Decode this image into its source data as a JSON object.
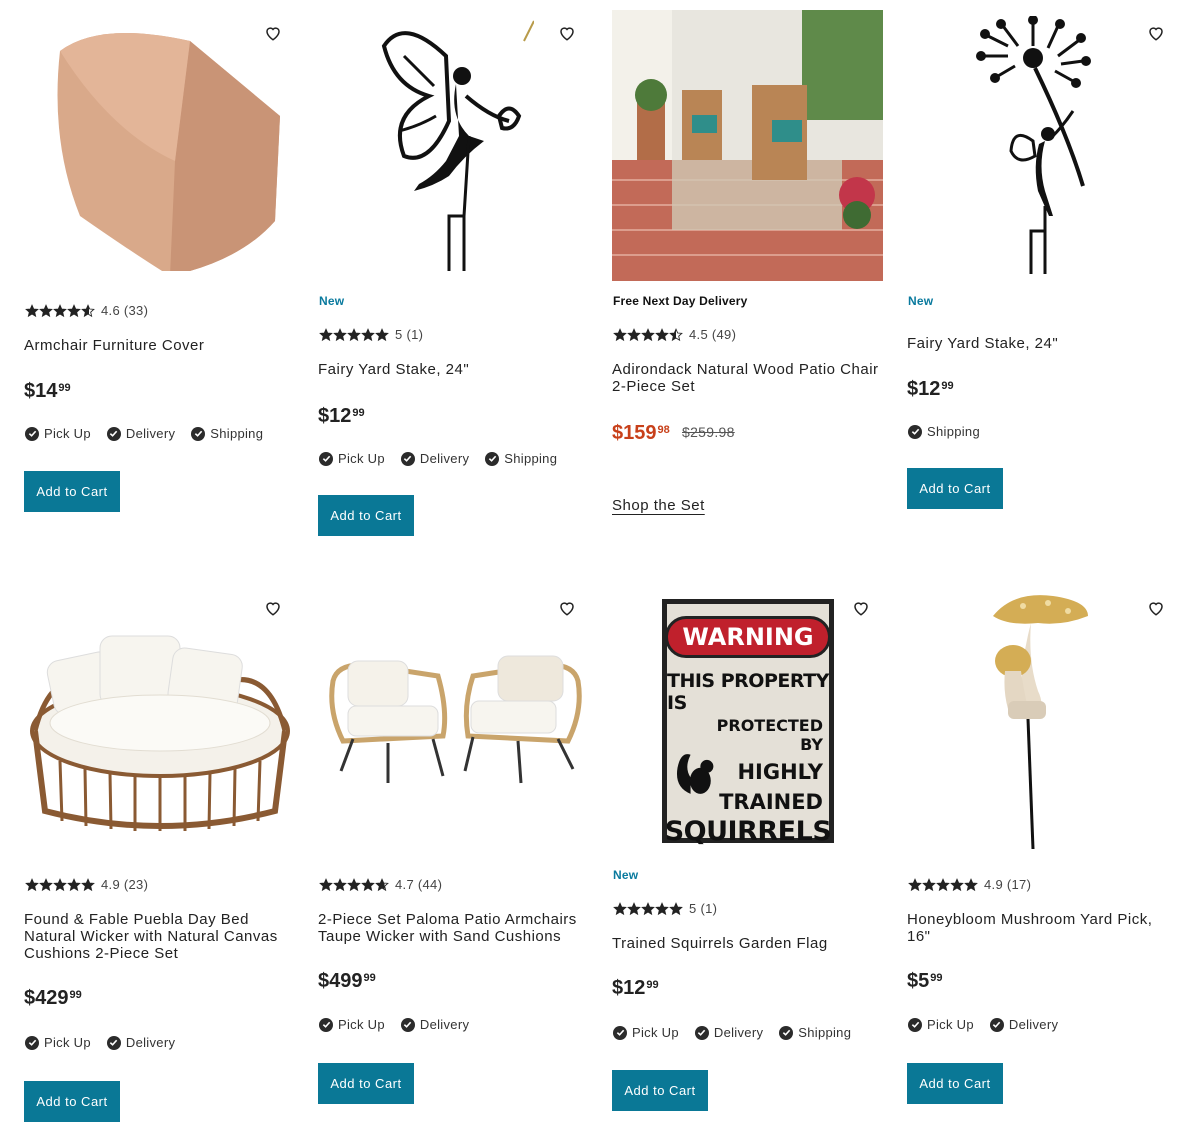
{
  "colors": {
    "accent": "#0a7896",
    "sale": "#c8401a",
    "tag": "#0a7a9e"
  },
  "cards": [
    {
      "title": "Armchair Furniture Cover",
      "tag": "",
      "rating": "4.6 (33)",
      "stars": 4.6,
      "price_dollars": "$14",
      "price_cents": "99",
      "fulfillment": [
        "Pick Up",
        "Delivery",
        "Shipping"
      ],
      "button": "Add to Cart",
      "image_icon": "armchair-cover-image"
    },
    {
      "title": "Fairy Yard Stake, 24\"",
      "tag": "New",
      "rating": "5 (1)",
      "stars": 5,
      "price_dollars": "$12",
      "price_cents": "99",
      "fulfillment": [
        "Pick Up",
        "Delivery",
        "Shipping"
      ],
      "button": "Add to Cart",
      "image_icon": "fairy-stake-image"
    },
    {
      "title": "Adirondack Natural Wood Patio Chair 2-Piece Set",
      "tag": "Free Next Day Delivery",
      "rating": "4.5 (49)",
      "stars": 4.5,
      "price_dollars": "$159",
      "price_cents": "98",
      "was_price": "$259.98",
      "link": "Shop the Set",
      "image_icon": "adirondack-chairs-image"
    },
    {
      "title": "Fairy Yard Stake, 24\"",
      "tag": "New",
      "rating": "",
      "stars": 0,
      "price_dollars": "$12",
      "price_cents": "99",
      "fulfillment": [
        "Shipping"
      ],
      "button": "Add to Cart",
      "image_icon": "dandelion-fairy-stake-image"
    },
    {
      "title": "Found & Fable Puebla Day Bed Natural Wicker with Natural Canvas Cushions 2-Piece Set",
      "tag": "",
      "rating": "4.9 (23)",
      "stars": 4.9,
      "price_dollars": "$429",
      "price_cents": "99",
      "fulfillment": [
        "Pick Up",
        "Delivery"
      ],
      "button": "Add to Cart",
      "image_icon": "day-bed-image"
    },
    {
      "title": "2-Piece Set Paloma Patio Armchairs Taupe Wicker with Sand Cushions",
      "tag": "",
      "rating": "4.7 (44)",
      "stars": 4.7,
      "price_dollars": "$499",
      "price_cents": "99",
      "fulfillment": [
        "Pick Up",
        "Delivery"
      ],
      "button": "Add to Cart",
      "image_icon": "wicker-armchairs-image"
    },
    {
      "title": "Trained Squirrels Garden Flag",
      "tag": "New",
      "rating": "5 (1)",
      "stars": 5,
      "price_dollars": "$12",
      "price_cents": "99",
      "fulfillment": [
        "Pick Up",
        "Delivery",
        "Shipping"
      ],
      "button": "Add to Cart",
      "image_icon": "squirrel-flag-image",
      "flag": {
        "warning": "WARNING",
        "line1": "THIS PROPERTY IS",
        "line2": "PROTECTED BY",
        "line3": "HIGHLY",
        "line4": "TRAINED",
        "line5": "SQUIRRELS"
      }
    },
    {
      "title": "Honeybloom Mushroom Yard Pick, 16\"",
      "tag": "",
      "rating": "4.9 (17)",
      "stars": 4.9,
      "price_dollars": "$5",
      "price_cents": "99",
      "fulfillment": [
        "Pick Up",
        "Delivery"
      ],
      "button": "Add to Cart",
      "image_icon": "mushroom-pick-image"
    }
  ]
}
